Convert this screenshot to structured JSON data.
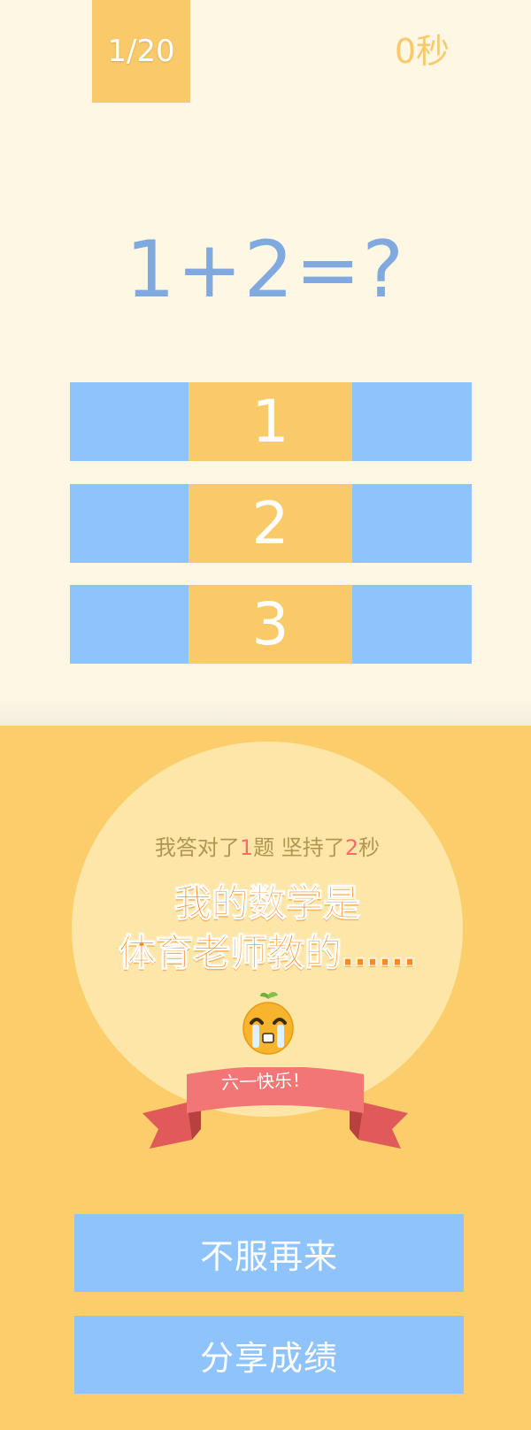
{
  "header": {
    "progress": "1/20",
    "timer": "0秒"
  },
  "question": {
    "text": "1+2=?"
  },
  "options": [
    {
      "label": "1"
    },
    {
      "label": "2"
    },
    {
      "label": "3"
    }
  ],
  "result": {
    "summary_prefix": "我答对了",
    "correct_count": "1",
    "summary_mid": "题 坚持了",
    "seconds": "2",
    "summary_suffix": "秒",
    "verdict_line1": "我的数学是",
    "verdict_line2": "体育老师教的……",
    "ribbon_text": "六一快乐！",
    "mascot_icon": "crying-orange-mascot"
  },
  "actions": {
    "retry_label": "不服再来",
    "share_label": "分享成绩"
  },
  "colors": {
    "background": "#fdf7e3",
    "accent_yellow": "#f9ca6a",
    "option_blue": "#8ec3fb",
    "question_blue": "#7fa9df",
    "result_bg": "#fbcd6b",
    "highlight_red": "#f66a6a",
    "ribbon_red": "#f27676"
  }
}
